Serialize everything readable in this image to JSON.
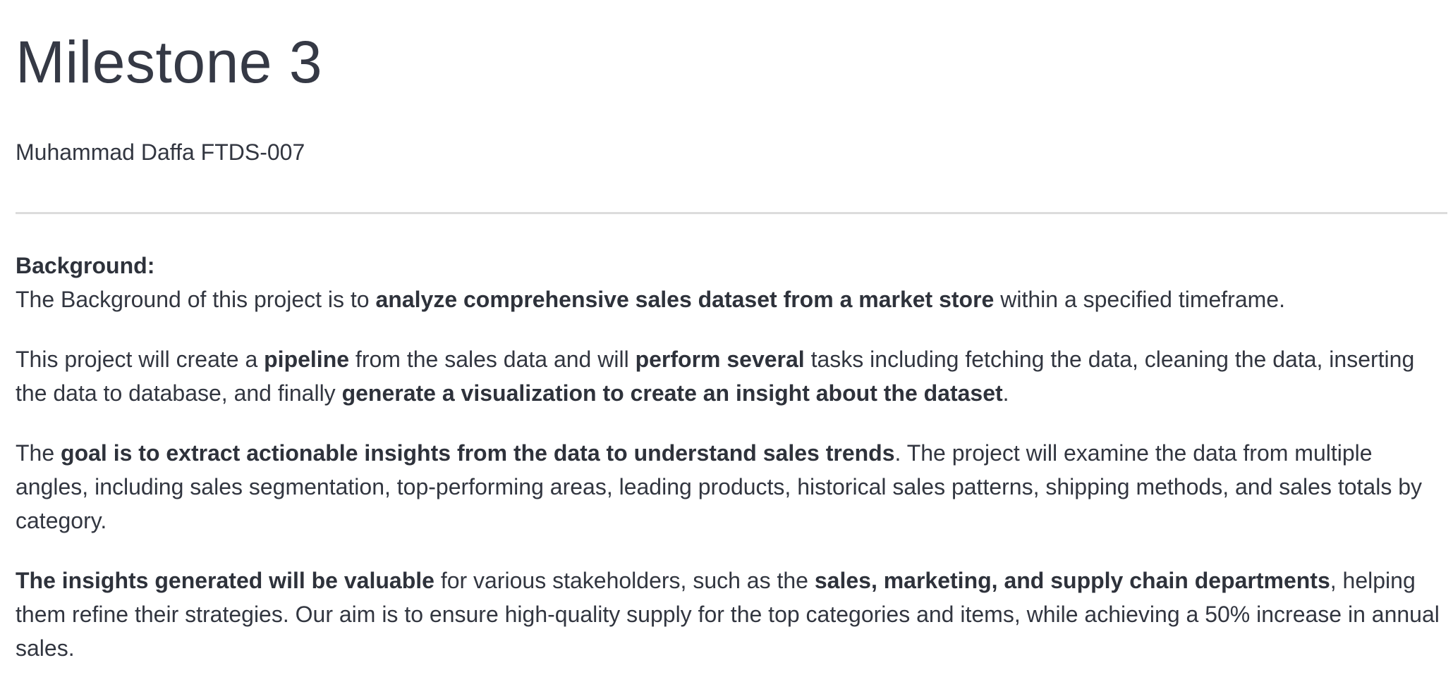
{
  "header": {
    "title": "Milestone 3",
    "author": "Muhammad Daffa FTDS-007"
  },
  "background": {
    "heading": "Background:",
    "p1": {
      "a": "The Background of this project is to ",
      "b": "analyze comprehensive sales dataset from a market store",
      "c": " within a specified timeframe."
    },
    "p2": {
      "a": "This project will create a ",
      "b": "pipeline",
      "c": " from the sales data and will ",
      "d": "perform several",
      "e": " tasks including fetching the data, cleaning the data, inserting the data to database, and finally ",
      "f": "generate a visualization to create an insight about the dataset",
      "g": "."
    },
    "p3": {
      "a": "The ",
      "b": "goal is to extract actionable insights from the data to understand sales trends",
      "c": ". The project will examine the data from multiple angles, including sales segmentation, top-performing areas, leading products, historical sales patterns, shipping methods, and sales totals by category."
    },
    "p4": {
      "a": "The insights generated will be valuable",
      "b": " for various stakeholders, such as the ",
      "c": "sales, marketing, and supply chain departments",
      "d": ", helping them refine their strategies. Our aim is to ensure high-quality supply for the top categories and items, while achieving a 50% increase in annual sales."
    }
  }
}
